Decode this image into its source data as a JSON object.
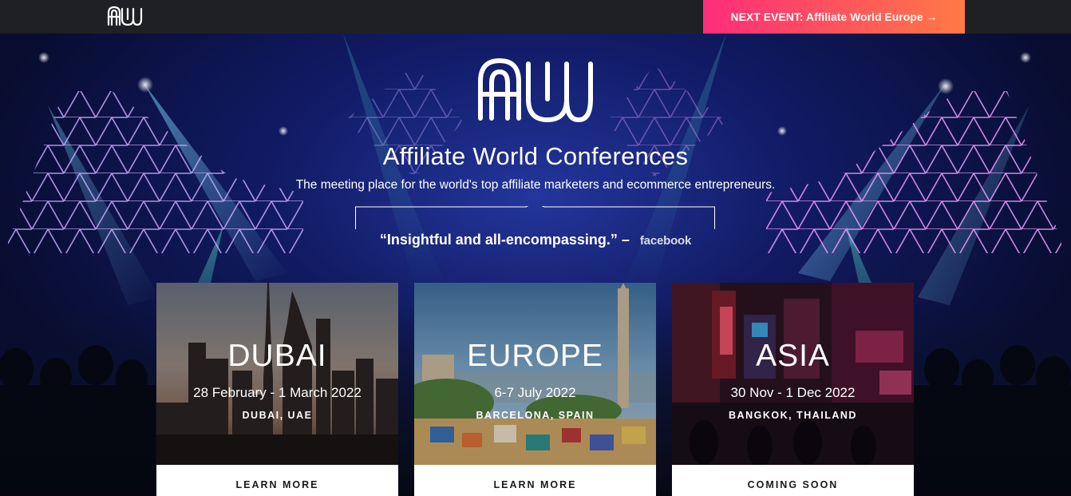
{
  "header": {
    "logo_icon": "aw-logo-icon",
    "next_event_label": "NEXT EVENT: Affiliate World Europe →",
    "next_event_colors": [
      "#ff2d7a",
      "#ff7a45"
    ]
  },
  "hero": {
    "logo_icon": "aw-logo-icon",
    "title": "Affiliate World Conferences",
    "tagline": "The meeting place for the world's top affiliate marketers and ecommerce entrepreneurs.",
    "quote": "“Insightful and all-encompassing.” –",
    "quote_source": "facebook"
  },
  "events": [
    {
      "city": "DUBAI",
      "date": "28 February - 1 March 2022",
      "location": "DUBAI, UAE",
      "button": "LEARN MORE"
    },
    {
      "city": "EUROPE",
      "date": "6-7 July 2022",
      "location": "BARCELONA, SPAIN",
      "button": "LEARN MORE"
    },
    {
      "city": "ASIA",
      "date": "30 Nov - 1 Dec 2022",
      "location": "BANGKOK, THAILAND",
      "button": "COMING SOON"
    }
  ]
}
